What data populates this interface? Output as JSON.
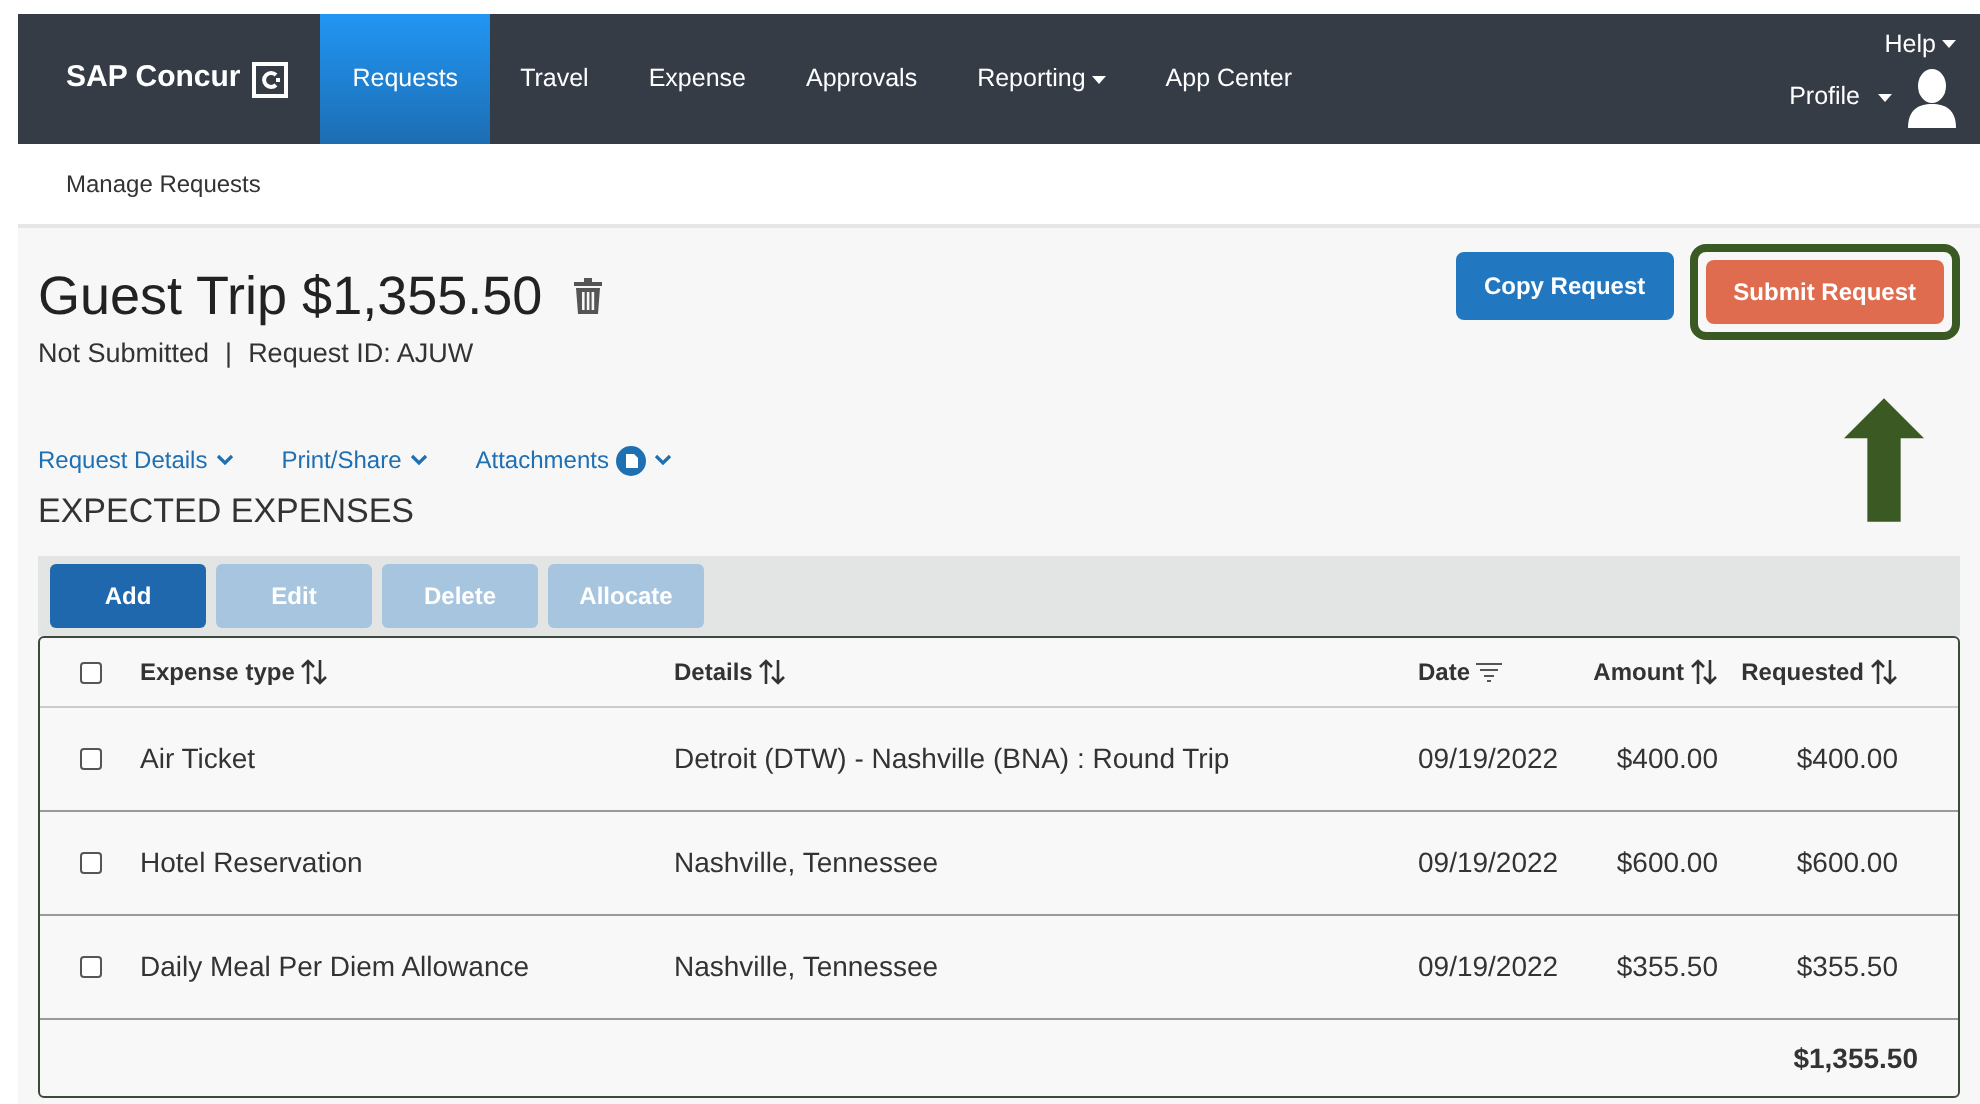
{
  "nav": {
    "brand": "SAP Concur",
    "items": [
      {
        "label": "Requests",
        "selected": true,
        "dropdown": false
      },
      {
        "label": "Travel",
        "selected": false,
        "dropdown": false
      },
      {
        "label": "Expense",
        "selected": false,
        "dropdown": false
      },
      {
        "label": "Approvals",
        "selected": false,
        "dropdown": false
      },
      {
        "label": "Reporting",
        "selected": false,
        "dropdown": true
      },
      {
        "label": "App Center",
        "selected": false,
        "dropdown": false
      }
    ],
    "help": "Help",
    "profile": "Profile"
  },
  "breadcrumb": "Manage Requests",
  "header": {
    "title": "Guest Trip $1,355.50",
    "status": "Not Submitted",
    "separator": "|",
    "request_id": "Request ID: AJUW",
    "buttons": [
      {
        "label": "Copy Request",
        "kind": "primary",
        "highlighted": false
      },
      {
        "label": "Submit Request",
        "kind": "submit",
        "highlighted": true
      }
    ]
  },
  "links": [
    {
      "label": "Request Details",
      "badge": false
    },
    {
      "label": "Print/Share",
      "badge": false
    },
    {
      "label": "Attachments",
      "badge": true
    }
  ],
  "section_title": "EXPECTED EXPENSES",
  "toolbar": [
    {
      "label": "Add",
      "disabled": false
    },
    {
      "label": "Edit",
      "disabled": true
    },
    {
      "label": "Delete",
      "disabled": true
    },
    {
      "label": "Allocate",
      "disabled": true
    }
  ],
  "table": {
    "header_checked": false,
    "columns": [
      {
        "label": "Expense type",
        "kind": "sort"
      },
      {
        "label": "Details",
        "kind": "sort"
      },
      {
        "label": "Date",
        "kind": "filter"
      },
      {
        "label": "Amount",
        "kind": "sort"
      },
      {
        "label": "Requested",
        "kind": "sort"
      }
    ],
    "rows": [
      {
        "checked": false,
        "cells": [
          "Air Ticket",
          "Detroit (DTW) - Nashville (BNA) : Round Trip",
          "09/19/2022",
          "$400.00",
          "$400.00"
        ]
      },
      {
        "checked": false,
        "cells": [
          "Hotel Reservation",
          "Nashville, Tennessee",
          "09/19/2022",
          "$600.00",
          "$600.00"
        ]
      },
      {
        "checked": false,
        "cells": [
          "Daily Meal Per Diem Allowance",
          "Nashville, Tennessee",
          "09/19/2022",
          "$355.50",
          "$355.50"
        ]
      }
    ],
    "total": "$1,355.50"
  }
}
